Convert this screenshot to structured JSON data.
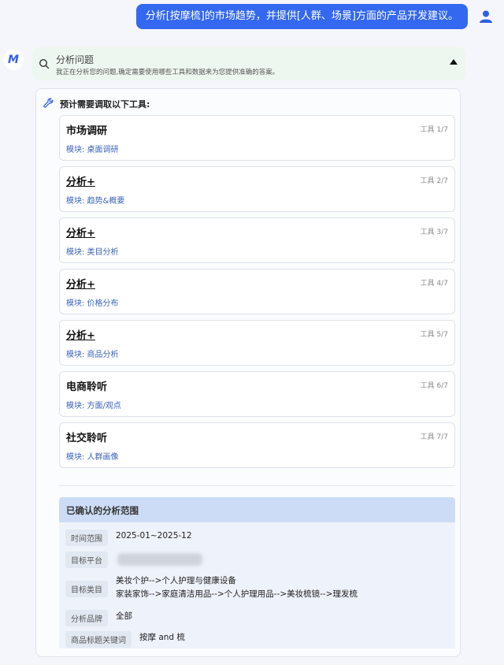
{
  "user_message": "分析[按摩梳]的市场趋势，并提供[人群、场景]方面的产品开发建议。",
  "assistant_logo": "M",
  "analysis": {
    "title": "分析问题",
    "subtitle": "我正在分析您的问题,确定需要使用哪些工具和数据来为您提供准确的答案。"
  },
  "tools": {
    "heading": "预计需要调取以下工具:",
    "items": [
      {
        "name": "市场调研",
        "index": "工具 1/7",
        "module": "模块: 桌面调研"
      },
      {
        "name": "分析+",
        "index": "工具 2/7",
        "module": "模块: 趋势&概要"
      },
      {
        "name": "分析+",
        "index": "工具 3/7",
        "module": "模块: 类目分析"
      },
      {
        "name": "分析+",
        "index": "工具 4/7",
        "module": "模块: 价格分布"
      },
      {
        "name": "分析+",
        "index": "工具 5/7",
        "module": "模块: 商品分析"
      },
      {
        "name": "电商聆听",
        "index": "工具 6/7",
        "module": "模块: 方面/观点"
      },
      {
        "name": "社交聆听",
        "index": "工具 7/7",
        "module": "模块: 人群画像"
      }
    ]
  },
  "scope": {
    "title": "已确认的分析范围",
    "rows": {
      "time_label": "时间范围",
      "time_value": "2025-01~2025-12",
      "platform_label": "目标平台",
      "category_label": "目标类目",
      "category_line1": "美妆个护-->个人护理与健康设备",
      "category_line2": "家装家饰-->家庭清洁用品-->个人护理用品-->美妆梳镜-->理发梳",
      "brand_label": "分析品牌",
      "brand_value": "全部",
      "keyword_label": "商品标题关键词",
      "keyword_value": "按摩 and 梳"
    }
  },
  "colors": {
    "accent": "#3468f0",
    "module_text": "#3a63b8",
    "scope_header": "#cddcf6"
  }
}
